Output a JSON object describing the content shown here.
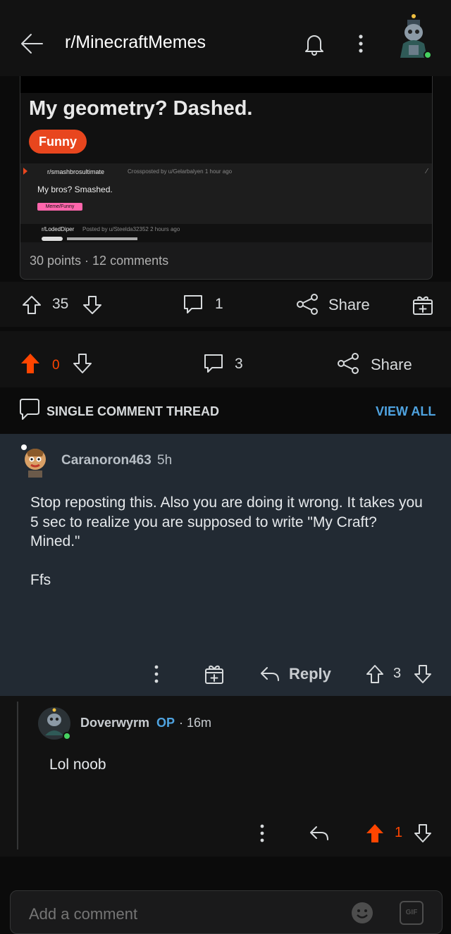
{
  "header": {
    "title": "r/MinecraftMemes",
    "back_icon": "arrow-left-icon",
    "bell_icon": "bell-icon",
    "more_icon": "vertical-dots-icon"
  },
  "post": {
    "screenshot": {
      "title": "My geometry? Dashed.",
      "flair": "Funny",
      "xpost_sub": "r/smashbrosultimate",
      "xpost_meta": "Crossposted by u/Gelarbalyen 1 hour ago",
      "xpost_title": "My bros? Smashed.",
      "xpost_tag": "Meme/Funny",
      "orig_sub": "r/LodedDiper",
      "orig_meta": "Posted by u/Steelda32352 2 hours ago"
    },
    "meta": "30 points · 12 comments",
    "score": "35",
    "comments": "1",
    "share_label": "Share"
  },
  "crosspost_bar": {
    "score": "0",
    "comments": "3",
    "share_label": "Share"
  },
  "thread": {
    "label": "SINGLE COMMENT THREAD",
    "view_all": "VIEW ALL"
  },
  "comment": {
    "user": "Caranoron463",
    "time": "5h",
    "body": "Stop reposting this. Also you are doing it wrong. It takes you 5 sec to realize you are supposed to write \"My Craft? Mined.\"\n\nFfs",
    "reply_label": "Reply",
    "score": "3"
  },
  "reply": {
    "user": "Doverwyrm",
    "op_badge": "OP",
    "time": "· 16m",
    "body": "Lol noob",
    "score": "1"
  },
  "composer": {
    "placeholder": "Add a comment",
    "gif_label": "GIF"
  },
  "colors": {
    "upvote": "#ff4500",
    "link_blue": "#4fa3e0",
    "online_dot": "#46d160"
  }
}
